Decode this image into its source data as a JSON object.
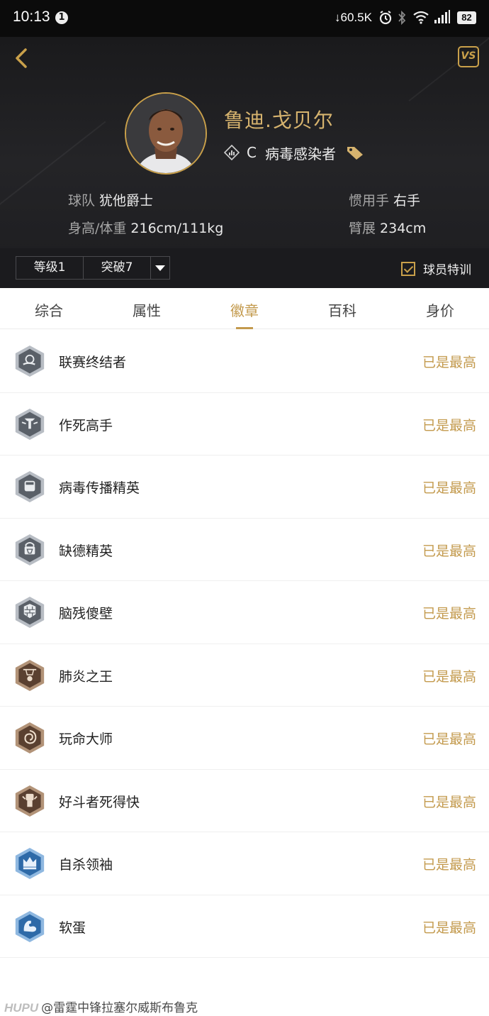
{
  "status_bar": {
    "time": "10:13",
    "notification_count": "1",
    "network_speed": "↓60.5K",
    "battery": "82"
  },
  "header": {
    "vs_label": "VS",
    "player_name": "鲁迪.戈贝尔",
    "position": "C",
    "role": "病毒感染者",
    "team_label": "球队",
    "team_value": "犹他爵士",
    "hand_label": "惯用手",
    "hand_value": "右手",
    "body_label": "身高/体重",
    "body_value": "216cm/111kg",
    "wingspan_label": "臂展",
    "wingspan_value": "234cm",
    "level_select": "等级1",
    "breakthrough_select": "突破7",
    "training_label": "球员特训"
  },
  "tabs": [
    {
      "label": "综合"
    },
    {
      "label": "属性"
    },
    {
      "label": "徽章"
    },
    {
      "label": "百科"
    },
    {
      "label": "身价"
    }
  ],
  "active_tab": "徽章",
  "badges": [
    {
      "name": "联赛终结者",
      "status": "已是最高",
      "tier": "silver",
      "icon": "basketball-dunk-icon"
    },
    {
      "name": "作死高手",
      "status": "已是最高",
      "tier": "silver",
      "icon": "winged-emblem-icon"
    },
    {
      "name": "病毒传播精英",
      "status": "已是最高",
      "tier": "silver",
      "icon": "fist-icon"
    },
    {
      "name": "缺德精英",
      "status": "已是最高",
      "tier": "silver",
      "icon": "lock-hoop-icon"
    },
    {
      "name": "脑残傻壁",
      "status": "已是最高",
      "tier": "silver",
      "icon": "brick-wall-icon"
    },
    {
      "name": "肺炎之王",
      "status": "已是最高",
      "tier": "bronze",
      "icon": "hoop-icon"
    },
    {
      "name": "玩命大师",
      "status": "已是最高",
      "tier": "bronze",
      "icon": "spiral-icon"
    },
    {
      "name": "好斗者死得快",
      "status": "已是最高",
      "tier": "bronze",
      "icon": "raised-fist-icon"
    },
    {
      "name": "自杀领袖",
      "status": "已是最高",
      "tier": "blue",
      "icon": "crown-icon"
    },
    {
      "name": "软蛋",
      "status": "已是最高",
      "tier": "blue",
      "icon": "muscle-arm-icon"
    }
  ],
  "colors": {
    "accent": "#c39a4d",
    "header_bg": "#1f1f22",
    "silver": "#9aa0a8",
    "bronze": "#8a6a50",
    "blue": "#3f7fc0"
  },
  "watermark": {
    "logo": "HUPU",
    "text": "@雷霆中锋拉塞尔威斯布鲁克"
  }
}
